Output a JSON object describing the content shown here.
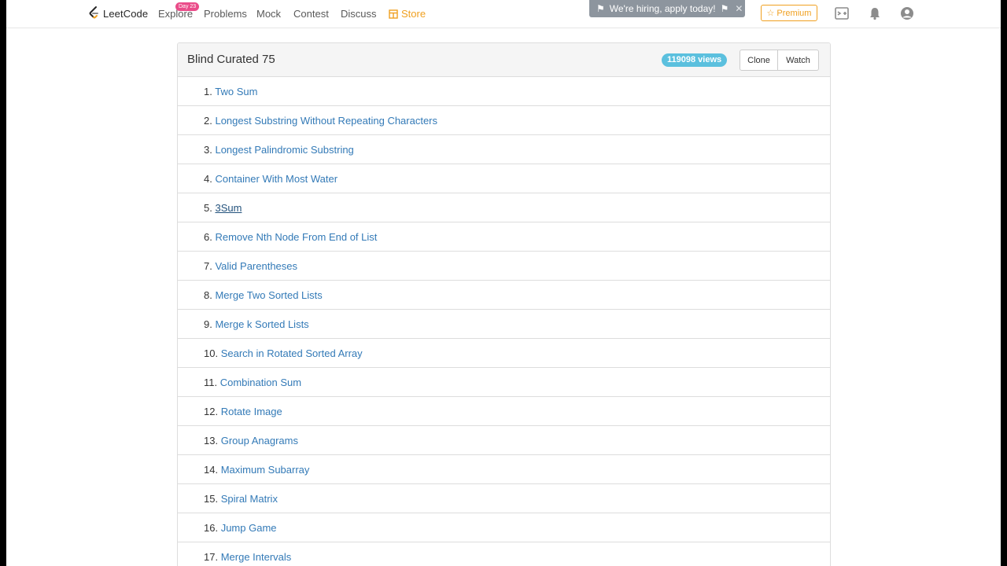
{
  "nav": {
    "brand": "LeetCode",
    "explore": "Explore",
    "explore_badge": "Day 23",
    "problems": "Problems",
    "mock": "Mock",
    "contest": "Contest",
    "discuss": "Discuss",
    "store": "Store",
    "hiring_banner": "We're hiring, apply today!",
    "premium": "Premium",
    "icons": [
      "playground-icon",
      "bell-icon",
      "user-avatar-icon"
    ]
  },
  "panel": {
    "title": "Blind Curated 75",
    "views": "119098 views",
    "clone": "Clone",
    "watch": "Watch"
  },
  "problems": [
    {
      "num": "1.",
      "title": "Two Sum"
    },
    {
      "num": "2.",
      "title": "Longest Substring Without Repeating Characters"
    },
    {
      "num": "3.",
      "title": "Longest Palindromic Substring"
    },
    {
      "num": "4.",
      "title": "Container With Most Water"
    },
    {
      "num": "5.",
      "title": "3Sum",
      "active": true
    },
    {
      "num": "6.",
      "title": "Remove Nth Node From End of List"
    },
    {
      "num": "7.",
      "title": "Valid Parentheses"
    },
    {
      "num": "8.",
      "title": "Merge Two Sorted Lists"
    },
    {
      "num": "9.",
      "title": "Merge k Sorted Lists"
    },
    {
      "num": "10.",
      "title": "Search in Rotated Sorted Array"
    },
    {
      "num": "11.",
      "title": "Combination Sum"
    },
    {
      "num": "12.",
      "title": "Rotate Image"
    },
    {
      "num": "13.",
      "title": "Group Anagrams"
    },
    {
      "num": "14.",
      "title": "Maximum Subarray"
    },
    {
      "num": "15.",
      "title": "Spiral Matrix"
    },
    {
      "num": "16.",
      "title": "Jump Game"
    },
    {
      "num": "17.",
      "title": "Merge Intervals"
    }
  ],
  "colors": {
    "link": "#337ab7",
    "store": "#f0a020",
    "badge": "#5bc0de",
    "explore_badge": "#ea4c89"
  }
}
